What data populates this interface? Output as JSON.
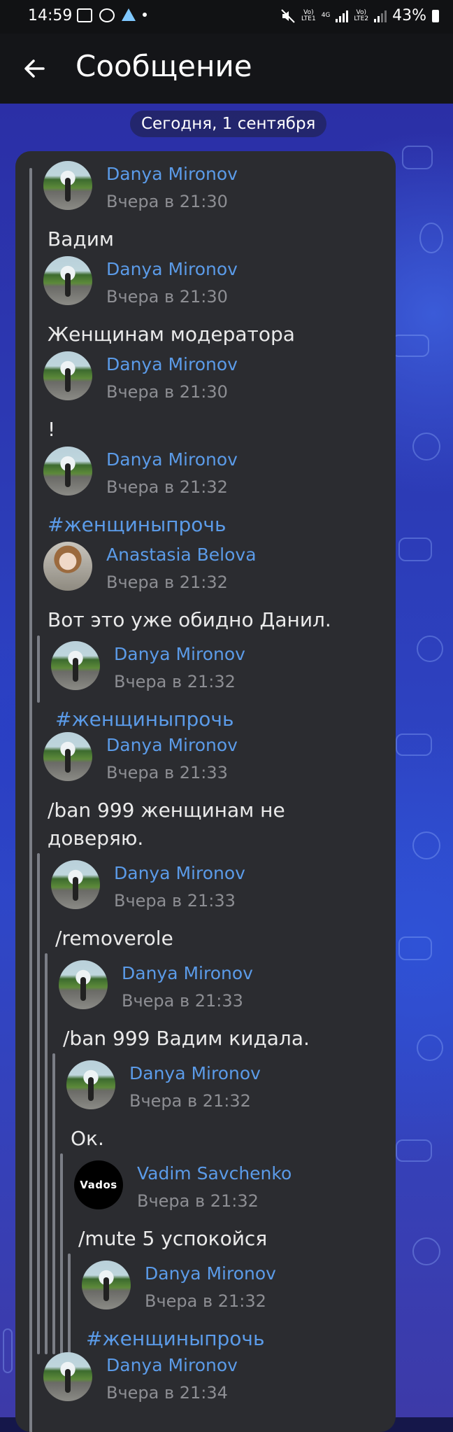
{
  "status_bar": {
    "time": "14:59",
    "battery": "43%",
    "sim1": "Vo)\nLTE1",
    "sim2": "Vo)\nLTE2",
    "net": "4G"
  },
  "app_bar": {
    "title": "Сообщение"
  },
  "date_divider": "Сегодня, 1 сентября",
  "messages": [
    {
      "author": "Danya Mironov",
      "time": "Вчера в 21:30",
      "text": "Вадим",
      "avatar": "road-avatar"
    },
    {
      "author": "Danya Mironov",
      "time": "Вчера в 21:30",
      "text": "Женщинам модератора",
      "avatar": "road-avatar"
    },
    {
      "author": "Danya Mironov",
      "time": "Вчера в 21:30",
      "text": "!",
      "avatar": "road-avatar"
    },
    {
      "author": "Danya Mironov",
      "time": "Вчера в 21:32",
      "text": "#женщиныпрочь",
      "avatar": "road-avatar"
    },
    {
      "author": "Anastasia Belova",
      "time": "Вчера в 21:32",
      "text": "Вот это уже обидно Данил.",
      "avatar": "girl-avatar"
    },
    {
      "author": "Danya Mironov",
      "time": "Вчера в 21:32",
      "text": "#женщиныпрочь",
      "avatar": "road-avatar"
    },
    {
      "author": "Danya Mironov",
      "time": "Вчера в 21:33",
      "text_line1": "/ban 999 женщинам не",
      "text_line2": "доверяю.",
      "avatar": "road-avatar"
    },
    {
      "author": "Danya Mironov",
      "time": "Вчера в 21:33",
      "text": "/removerole",
      "avatar": "road-avatar"
    },
    {
      "author": "Danya Mironov",
      "time": "Вчера в 21:33",
      "text": "/ban 999 Вадим кидала.",
      "avatar": "road-avatar"
    },
    {
      "author": "Danya Mironov",
      "time": "Вчера в 21:32",
      "text": "Ок.",
      "avatar": "road-avatar"
    },
    {
      "author": "Vadim Savchenko",
      "time": "Вчера в 21:32",
      "text": "/mute 5 успокойся",
      "avatar": "vados-avatar",
      "avatar_text": "Vados"
    },
    {
      "author": "Danya Mironov",
      "time": "Вчера в 21:32",
      "text": "#женщиныпрочь",
      "avatar": "road-avatar"
    },
    {
      "author": "Danya Mironov",
      "time": "Вчера в 21:34",
      "text": "",
      "avatar": "road-avatar"
    }
  ]
}
